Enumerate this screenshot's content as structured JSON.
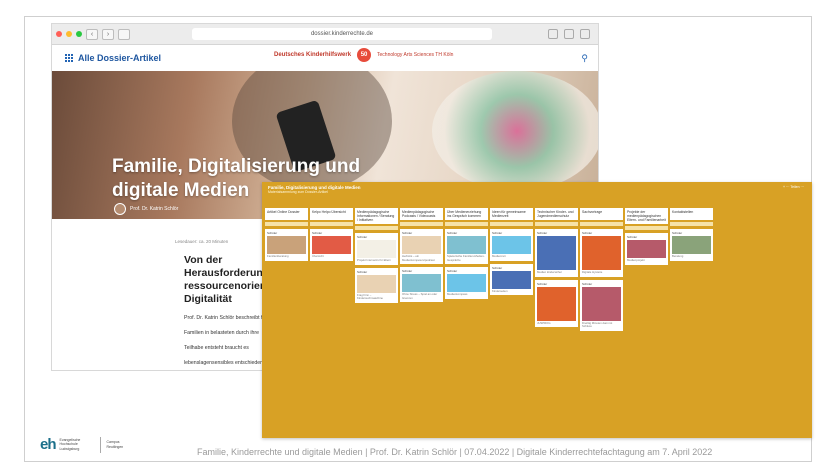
{
  "browser": {
    "url": "dossier.kinderrechte.de",
    "site_title": "Alle Dossier-Artikel",
    "logo_kids": "Deutsches Kinderhilfswerk",
    "logo_badge": "50",
    "logo_tu": "Technology Arts Sciences TH Köln",
    "hero_title": "Familie, Digitalisierung und digitale Medien",
    "author": "Prof. Dr. Katrin Schlör",
    "meta": "Lesedauer: ca. 20 Minuten",
    "article_heading": "Von der Herausforderung ressourcenorientiert Digitalität",
    "article_text": "Prof. Dr. Katrin Schlör beschreibt für Familien in belasteten durch ihre Teilhabe entsteht braucht es lebenslagensensibles entschiedenes Vorgehen"
  },
  "padlet": {
    "title": "Familie, Digitalisierung und digitale Medien",
    "subtitle": "Materialsammlung zum Dossier-Artikel",
    "menu": "+ ⋯ Teilen ⋯",
    "columns": [
      {
        "header": "Artikel Online Dossier",
        "cards": [
          {
            "label": "Schöler",
            "text": "Familienberatung"
          }
        ]
      },
      {
        "header": "Kelpo Helpo Übersicht",
        "cards": [
          {
            "label": "Schöler",
            "text": "Übersicht"
          }
        ]
      },
      {
        "header": "Medienpädagogische Informationen / Beratung / Initiativen",
        "cards": [
          {
            "label": "Schöler",
            "text": "Projekt Internetzs für Eltern"
          },
          {
            "label": "Schöler",
            "text": "Frag Finn – Kindersuchmaschine"
          }
        ]
      },
      {
        "header": "Medienpädagogische Podcasts / Videocasts",
        "cards": [
          {
            "label": "Schöler",
            "text": "Herbstis – ein Medienkompetenzpodcast"
          },
          {
            "label": "Schöler",
            "text": "Ohne Stress – Spiel an oder Grenzen"
          }
        ]
      },
      {
        "header": "Über Medienerziehung ins Gespräch kommen",
        "cards": [
          {
            "label": "Schöler",
            "text": "Spielerische Familien-Medien-Gespräche"
          },
          {
            "label": "Schöler",
            "text": "Medienkompass"
          }
        ]
      },
      {
        "header": "Ideen für gemeinsame Medienzeit",
        "cards": [
          {
            "label": "Schöler",
            "text": "Medienzeit"
          },
          {
            "label": "Schöler",
            "text": "Kinderseiten"
          }
        ]
      },
      {
        "header": "Technischer Kinder- und Jugendmedienschutz",
        "cards": [
          {
            "label": "Schöler",
            "text": "Medien kindersicher"
          },
          {
            "label": "Schöler",
            "text": "JUSPROG"
          }
        ]
      },
      {
        "header": "Sachvortrage",
        "cards": [
          {
            "label": "Schöler",
            "text": "Digitale Hysterie"
          },
          {
            "label": "Schöler",
            "text": "Dreißig Minuten dann ist Schluss"
          }
        ]
      },
      {
        "header": "Projekte der medienpädagogischen Eltern- und Familienarbeit",
        "cards": [
          {
            "label": "Schöler",
            "text": "Medienprojekt"
          }
        ]
      },
      {
        "header": "Kontaktstellen",
        "cards": [
          {
            "label": "Schöler",
            "text": "Beratung"
          }
        ]
      }
    ]
  },
  "footer": {
    "logo_letters": "eh",
    "logo_text": "Evangelische Hochschule Ludwigsburg",
    "campus": "Campus Reutlingen",
    "text": "Familie, Kinderrechte und digitale Medien  | Prof. Dr. Katrin Schlör | 07.04.2022 | Digitale Kinderrechtefachtagung am 7. April 2022"
  },
  "colors": {
    "padlet_bg": "#d8a125",
    "brand_blue": "#1f57a0",
    "footer_text": "#9a9a9a"
  }
}
